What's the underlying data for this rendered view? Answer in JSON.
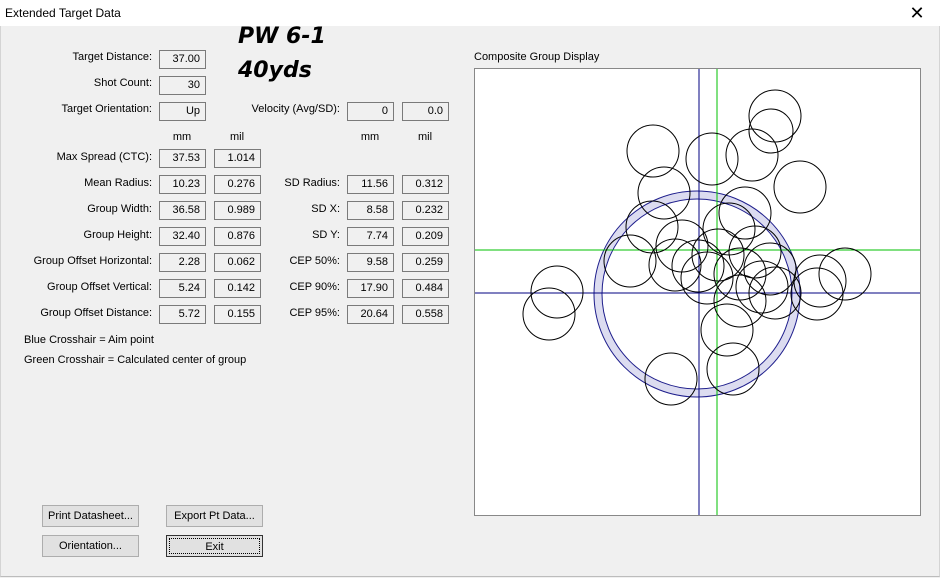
{
  "window": {
    "title": "Extended Target Data",
    "close_glyph": "✕"
  },
  "header": {
    "line1": "PW 6-1",
    "line2": "40yds"
  },
  "fields": {
    "target_distance": {
      "label": "Target Distance:",
      "value": "37.00"
    },
    "shot_count": {
      "label": "Shot Count:",
      "value": "30"
    },
    "target_orientation": {
      "label": "Target Orientation:",
      "value": "Up"
    },
    "velocity": {
      "label": "Velocity (Avg/SD):",
      "avg": "0",
      "sd": "0.0"
    }
  },
  "units": {
    "mm": "mm",
    "mil": "mil"
  },
  "left_stats": [
    {
      "label": "Max Spread (CTC):",
      "mm": "37.53",
      "mil": "1.014"
    },
    {
      "label": "Mean Radius:",
      "mm": "10.23",
      "mil": "0.276"
    },
    {
      "label": "Group Width:",
      "mm": "36.58",
      "mil": "0.989"
    },
    {
      "label": "Group Height:",
      "mm": "32.40",
      "mil": "0.876"
    },
    {
      "label": "Group Offset Horizontal:",
      "mm": "2.28",
      "mil": "0.062"
    },
    {
      "label": "Group Offset Vertical:",
      "mm": "5.24",
      "mil": "0.142"
    },
    {
      "label": "Group Offset Distance:",
      "mm": "5.72",
      "mil": "0.155"
    }
  ],
  "right_stats": [
    {
      "label": "SD Radius:",
      "mm": "11.56",
      "mil": "0.312"
    },
    {
      "label": "SD X:",
      "mm": "8.58",
      "mil": "0.232"
    },
    {
      "label": "SD Y:",
      "mm": "7.74",
      "mil": "0.209"
    },
    {
      "label": "CEP 50%:",
      "mm": "9.58",
      "mil": "0.259"
    },
    {
      "label": "CEP 90%:",
      "mm": "17.90",
      "mil": "0.484"
    },
    {
      "label": "CEP 95%:",
      "mm": "20.64",
      "mil": "0.558"
    }
  ],
  "legend": {
    "blue": "Blue Crosshair = Aim point",
    "green": "Green Crosshair = Calculated center of group"
  },
  "plot": {
    "label": "Composite Group Display",
    "aim_color": "#000080",
    "center_color": "#00c000",
    "ring_color": "#1e1e8c",
    "ring_fill": "#dcdcf0"
  },
  "buttons": {
    "print": "Print Datasheet...",
    "export": "Export Pt Data...",
    "orientation": "Orientation...",
    "exit": "Exit"
  }
}
